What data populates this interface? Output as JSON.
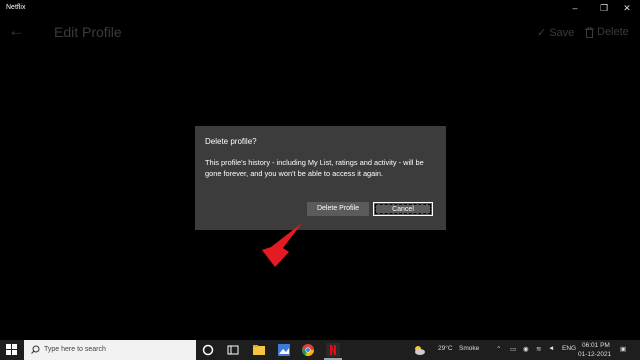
{
  "window": {
    "title": "Netflix"
  },
  "header": {
    "title": "Edit Profile",
    "save_label": "Save",
    "delete_label": "Delete"
  },
  "dialog": {
    "title": "Delete profile?",
    "message": "This profile's history - including My List, ratings and activity - will be gone forever, and you won't be able to access it again.",
    "delete_button": "Delete Profile",
    "cancel_button": "Cancel"
  },
  "taskbar": {
    "search_placeholder": "Type here to search",
    "weather_temp": "29°C",
    "weather_text": "Smoke",
    "language": "ENG",
    "time": "06:01 PM",
    "date": "01-12-2021"
  },
  "colors": {
    "dialog_bg": "#3c3c3c",
    "netflix_red": "#e50914",
    "arrow_red": "#e31b23"
  }
}
